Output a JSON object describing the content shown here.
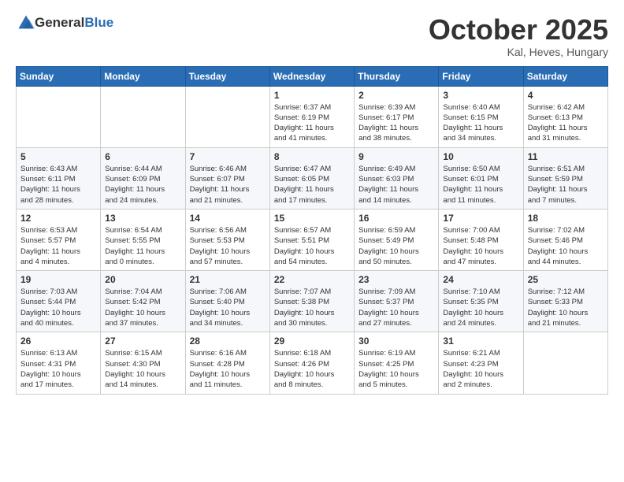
{
  "logo": {
    "general": "General",
    "blue": "Blue"
  },
  "header": {
    "month": "October 2025",
    "location": "Kal, Heves, Hungary"
  },
  "weekdays": [
    "Sunday",
    "Monday",
    "Tuesday",
    "Wednesday",
    "Thursday",
    "Friday",
    "Saturday"
  ],
  "weeks": [
    [
      {
        "day": "",
        "info": ""
      },
      {
        "day": "",
        "info": ""
      },
      {
        "day": "",
        "info": ""
      },
      {
        "day": "1",
        "info": "Sunrise: 6:37 AM\nSunset: 6:19 PM\nDaylight: 11 hours\nand 41 minutes."
      },
      {
        "day": "2",
        "info": "Sunrise: 6:39 AM\nSunset: 6:17 PM\nDaylight: 11 hours\nand 38 minutes."
      },
      {
        "day": "3",
        "info": "Sunrise: 6:40 AM\nSunset: 6:15 PM\nDaylight: 11 hours\nand 34 minutes."
      },
      {
        "day": "4",
        "info": "Sunrise: 6:42 AM\nSunset: 6:13 PM\nDaylight: 11 hours\nand 31 minutes."
      }
    ],
    [
      {
        "day": "5",
        "info": "Sunrise: 6:43 AM\nSunset: 6:11 PM\nDaylight: 11 hours\nand 28 minutes."
      },
      {
        "day": "6",
        "info": "Sunrise: 6:44 AM\nSunset: 6:09 PM\nDaylight: 11 hours\nand 24 minutes."
      },
      {
        "day": "7",
        "info": "Sunrise: 6:46 AM\nSunset: 6:07 PM\nDaylight: 11 hours\nand 21 minutes."
      },
      {
        "day": "8",
        "info": "Sunrise: 6:47 AM\nSunset: 6:05 PM\nDaylight: 11 hours\nand 17 minutes."
      },
      {
        "day": "9",
        "info": "Sunrise: 6:49 AM\nSunset: 6:03 PM\nDaylight: 11 hours\nand 14 minutes."
      },
      {
        "day": "10",
        "info": "Sunrise: 6:50 AM\nSunset: 6:01 PM\nDaylight: 11 hours\nand 11 minutes."
      },
      {
        "day": "11",
        "info": "Sunrise: 6:51 AM\nSunset: 5:59 PM\nDaylight: 11 hours\nand 7 minutes."
      }
    ],
    [
      {
        "day": "12",
        "info": "Sunrise: 6:53 AM\nSunset: 5:57 PM\nDaylight: 11 hours\nand 4 minutes."
      },
      {
        "day": "13",
        "info": "Sunrise: 6:54 AM\nSunset: 5:55 PM\nDaylight: 11 hours\nand 0 minutes."
      },
      {
        "day": "14",
        "info": "Sunrise: 6:56 AM\nSunset: 5:53 PM\nDaylight: 10 hours\nand 57 minutes."
      },
      {
        "day": "15",
        "info": "Sunrise: 6:57 AM\nSunset: 5:51 PM\nDaylight: 10 hours\nand 54 minutes."
      },
      {
        "day": "16",
        "info": "Sunrise: 6:59 AM\nSunset: 5:49 PM\nDaylight: 10 hours\nand 50 minutes."
      },
      {
        "day": "17",
        "info": "Sunrise: 7:00 AM\nSunset: 5:48 PM\nDaylight: 10 hours\nand 47 minutes."
      },
      {
        "day": "18",
        "info": "Sunrise: 7:02 AM\nSunset: 5:46 PM\nDaylight: 10 hours\nand 44 minutes."
      }
    ],
    [
      {
        "day": "19",
        "info": "Sunrise: 7:03 AM\nSunset: 5:44 PM\nDaylight: 10 hours\nand 40 minutes."
      },
      {
        "day": "20",
        "info": "Sunrise: 7:04 AM\nSunset: 5:42 PM\nDaylight: 10 hours\nand 37 minutes."
      },
      {
        "day": "21",
        "info": "Sunrise: 7:06 AM\nSunset: 5:40 PM\nDaylight: 10 hours\nand 34 minutes."
      },
      {
        "day": "22",
        "info": "Sunrise: 7:07 AM\nSunset: 5:38 PM\nDaylight: 10 hours\nand 30 minutes."
      },
      {
        "day": "23",
        "info": "Sunrise: 7:09 AM\nSunset: 5:37 PM\nDaylight: 10 hours\nand 27 minutes."
      },
      {
        "day": "24",
        "info": "Sunrise: 7:10 AM\nSunset: 5:35 PM\nDaylight: 10 hours\nand 24 minutes."
      },
      {
        "day": "25",
        "info": "Sunrise: 7:12 AM\nSunset: 5:33 PM\nDaylight: 10 hours\nand 21 minutes."
      }
    ],
    [
      {
        "day": "26",
        "info": "Sunrise: 6:13 AM\nSunset: 4:31 PM\nDaylight: 10 hours\nand 17 minutes."
      },
      {
        "day": "27",
        "info": "Sunrise: 6:15 AM\nSunset: 4:30 PM\nDaylight: 10 hours\nand 14 minutes."
      },
      {
        "day": "28",
        "info": "Sunrise: 6:16 AM\nSunset: 4:28 PM\nDaylight: 10 hours\nand 11 minutes."
      },
      {
        "day": "29",
        "info": "Sunrise: 6:18 AM\nSunset: 4:26 PM\nDaylight: 10 hours\nand 8 minutes."
      },
      {
        "day": "30",
        "info": "Sunrise: 6:19 AM\nSunset: 4:25 PM\nDaylight: 10 hours\nand 5 minutes."
      },
      {
        "day": "31",
        "info": "Sunrise: 6:21 AM\nSunset: 4:23 PM\nDaylight: 10 hours\nand 2 minutes."
      },
      {
        "day": "",
        "info": ""
      }
    ]
  ]
}
